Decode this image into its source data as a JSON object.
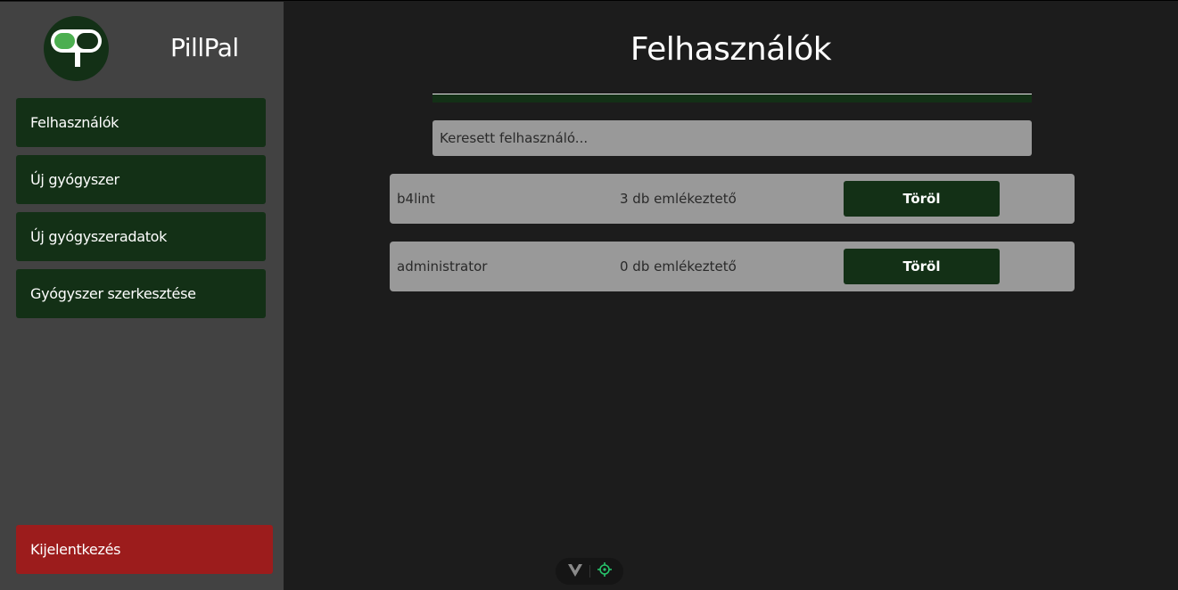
{
  "app": {
    "brand": "PillPal",
    "logo_icon": "pillpal-logo-icon",
    "colors": {
      "sidebar_bg": "#424242",
      "main_bg": "#1c1c1c",
      "accent_green": "#133016",
      "logo_green": "#4caf50",
      "logout_red": "#9c1c1c",
      "row_bg": "#999999"
    }
  },
  "sidebar": {
    "items": [
      {
        "label": "Felhasználók"
      },
      {
        "label": "Új gyógyszer"
      },
      {
        "label": "Új gyógyszeradatok"
      },
      {
        "label": "Gyógyszer szerkesztése"
      }
    ],
    "logout_label": "Kijelentkezés"
  },
  "main": {
    "title": "Felhasználók",
    "search": {
      "placeholder": "Keresett felhasználó...",
      "value": ""
    },
    "users": [
      {
        "name": "b4lint",
        "reminders": "3 db emlékeztető",
        "delete_label": "Töröl"
      },
      {
        "name": "administrator",
        "reminders": "0 db emlékeztető",
        "delete_label": "Töröl"
      }
    ]
  },
  "devtools": {
    "icons": [
      "vue-logo-icon",
      "crosshair-icon"
    ]
  }
}
